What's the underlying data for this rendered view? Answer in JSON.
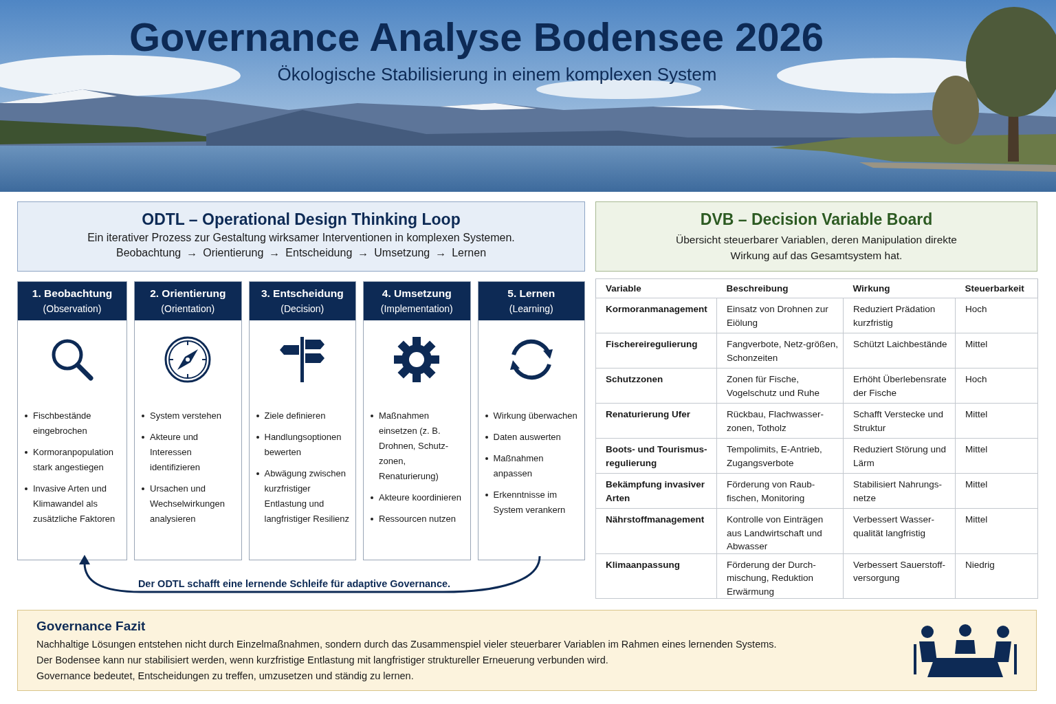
{
  "header": {
    "title": "Governance Analyse Bodensee 2026",
    "subtitle": "Ökologische Stabilisierung in einem komplexen System"
  },
  "odtl": {
    "title": "ODTL – Operational Design Thinking Loop",
    "description": "Ein iterativer Prozess zur Gestaltung wirksamer Interventionen in komplexen Systemen.",
    "flow": [
      "Beobachtung",
      "→",
      "Orientierung",
      "→",
      "Entscheidung",
      "→",
      "Umsetzung",
      "→",
      "Lernen"
    ],
    "steps": [
      {
        "title": "1. Beobachtung",
        "subtitle": "(Observation)",
        "bullets": [
          "Fischbestände eingebrochen",
          "Kormoranpopulation stark angestiegen",
          "Invasive Arten und Klimawandel als zusätzliche Faktoren"
        ]
      },
      {
        "title": "2. Orientierung",
        "subtitle": "(Orientation)",
        "bullets": [
          "System verstehen",
          "Akteure und Interessen identifizieren",
          "Ursachen und Wechselwirkungen analysieren"
        ]
      },
      {
        "title": "3. Entscheidung",
        "subtitle": "(Decision)",
        "bullets": [
          "Ziele definieren",
          "Handlungsoptionen bewerten",
          "Abwägung zwischen kurzfristiger Entlastung und langfristiger Resilienz"
        ]
      },
      {
        "title": "4. Umsetzung",
        "subtitle": "(Implementation)",
        "bullets": [
          "Maßnahmen einsetzen (z. B. Drohnen, Schutz-zonen, Renaturierung)",
          "Akteure koordinieren",
          "Ressourcen nutzen"
        ]
      },
      {
        "title": "5. Lernen",
        "subtitle": "(Learning)",
        "bullets": [
          "Wirkung überwachen",
          "Daten auswerten",
          "Maßnahmen anpassen",
          "Erkenntnisse im System verankern"
        ]
      }
    ],
    "loop_caption": "Der ODTL schafft eine lernende Schleife für adaptive Governance."
  },
  "dvb": {
    "title": "DVB – Decision Variable Board",
    "description": "Übersicht steuerbarer Variablen, deren Manipulation direkte Wirkung auf das Gesamtsystem hat.",
    "columns": [
      "Variable",
      "Beschreibung",
      "Wirkung",
      "Steuerbarkeit"
    ],
    "rows": [
      [
        "Kormoranmanagement",
        "Einsatz von Drohnen zur Eiölung",
        "Reduziert Prädation kurzfristig",
        "Hoch"
      ],
      [
        "Fischereiregulierung",
        "Fangverbote, Netz-größen, Schonzeiten",
        "Schützt Laichbestände",
        "Mittel"
      ],
      [
        "Schutzzonen",
        "Zonen für Fische, Vogelschutz und Ruhe",
        "Erhöht Überlebensrate der Fische",
        "Hoch"
      ],
      [
        "Renaturierung Ufer",
        "Rückbau, Flachwasser-zonen, Totholz",
        "Schafft Verstecke und Struktur",
        "Mittel"
      ],
      [
        "Boots- und Tourismus-regulierung",
        "Tempolimits, E-Antrieb, Zugangsverbote",
        "Reduziert Störung und Lärm",
        "Mittel"
      ],
      [
        "Bekämpfung invasiver Arten",
        "Förderung von Raub-fischen, Monitoring",
        "Stabilisiert Nahrungs-netze",
        "Mittel"
      ],
      [
        "Nährstoffmanagement",
        "Kontrolle von Einträgen aus Landwirtschaft und Abwasser",
        "Verbessert Wasser-qualität langfristig",
        "Mittel"
      ],
      [
        "Klimaanpassung",
        "Förderung der Durch-mischung, Reduktion Erwärmung",
        "Verbessert Sauerstoff-versorgung",
        "Niedrig"
      ]
    ]
  },
  "fazit": {
    "title": "Governance Fazit",
    "lines": [
      "Nachhaltige Lösungen entstehen nicht durch Einzelmaßnahmen, sondern durch das Zusammenspiel vieler steuerbarer Variablen im Rahmen eines lernenden Systems.",
      "Der Bodensee kann nur stabilisiert werden, wenn kurzfristige Entlastung mit langfristiger struktureller Erneuerung verbunden wird.",
      "Governance bedeutet, Entscheidungen zu treffen, umzusetzen und ständig zu lernen."
    ]
  }
}
